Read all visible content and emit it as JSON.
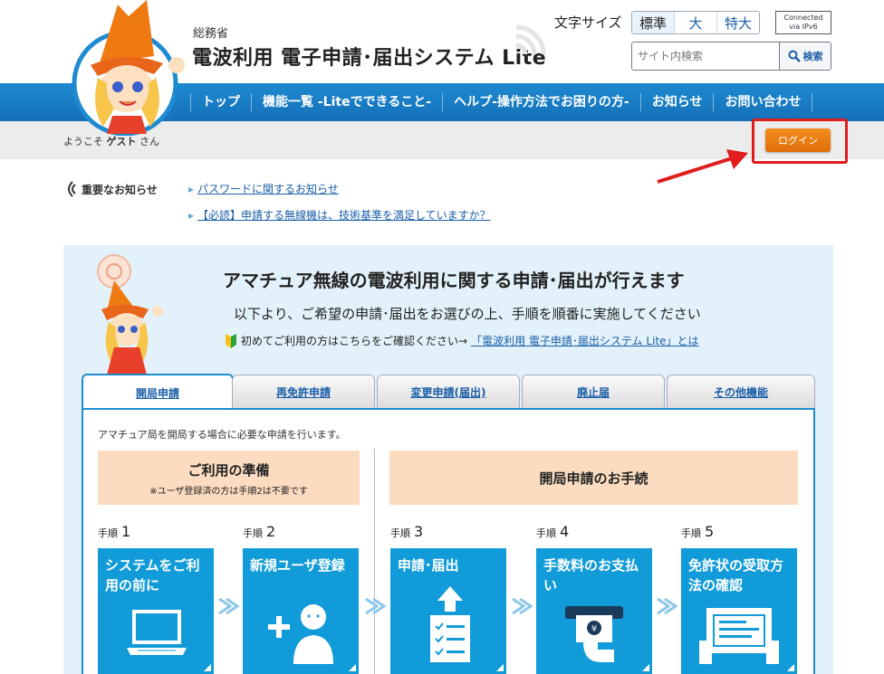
{
  "header": {
    "ministry": "総務省",
    "site_title": "電波利用 電子申請･届出システム Lite",
    "font_size_label": "文字サイズ",
    "font_sizes": [
      "標準",
      "大",
      "特大"
    ],
    "ipv6_line1": "Connected",
    "ipv6_line2": "via IPv6",
    "search_placeholder": "サイト内検索",
    "search_button": "検索"
  },
  "nav": {
    "items": [
      "トップ",
      "機能一覧 -Liteでできること-",
      "ヘルプ-操作方法でお困りの方-",
      "お知らせ",
      "お問い合わせ"
    ]
  },
  "welcome": {
    "prefix": "ようこそ",
    "user": "ゲスト",
    "suffix": "さん",
    "login_button": "ログイン"
  },
  "notices": {
    "heading": "重要なお知らせ",
    "links": [
      "パスワードに関するお知らせ",
      "【必読】申請する無線機は、技術基準を満足していますか？"
    ]
  },
  "panel": {
    "title": "アマチュア無線の電波利用に関する申請･届出が行えます",
    "subtitle": "以下より、ご希望の申請･届出をお選びの上、手順を順番に実施してください",
    "beginner_text": "初めてご利用の方はこちらをご確認ください→",
    "beginner_link": "「電波利用 電子申請･届出システム Lite」とは"
  },
  "tabs": [
    "開局申請",
    "再免許申請",
    "変更申請(届出)",
    "廃止届",
    "その他機能"
  ],
  "tab_content": {
    "description": "アマチュア局を開局する場合に必要な申請を行います。",
    "prep_title": "ご利用の準備",
    "prep_note": "※ユーザ登録済の方は手順2は不要です",
    "proc_title": "開局申請のお手続",
    "step_word": "手順",
    "steps": [
      {
        "num": "1",
        "title": "システムをご利用の前に"
      },
      {
        "num": "2",
        "title": "新規ユーザ登録"
      },
      {
        "num": "3",
        "title": "申請･届出"
      },
      {
        "num": "4",
        "title": "手数料のお支払い"
      },
      {
        "num": "5",
        "title": "免許状の受取方法の確認"
      }
    ]
  },
  "colors": {
    "nav_blue": "#1e8ad0",
    "step_blue": "#129bd9",
    "login_orange": "#f28c1c",
    "highlight_red": "#e01c1c",
    "prep_peach": "#fcdcc0",
    "panel_bg": "#e3f2fa"
  }
}
